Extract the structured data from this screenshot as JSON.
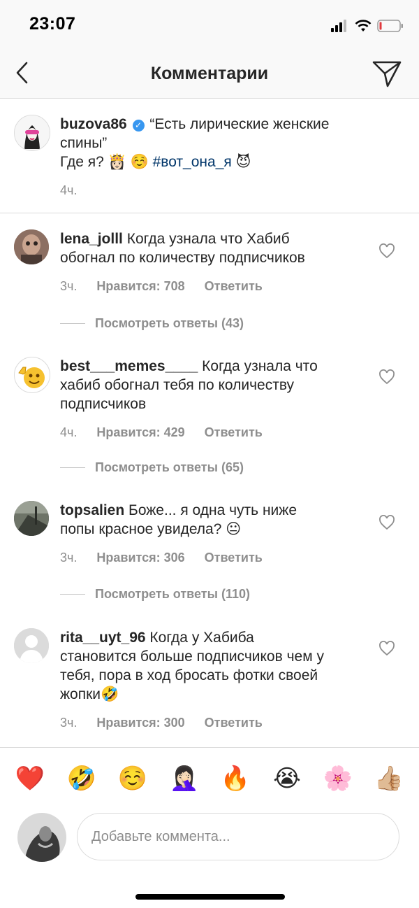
{
  "status_bar": {
    "time": "23:07"
  },
  "header": {
    "title": "Комментарии"
  },
  "caption": {
    "username": "buzova86",
    "text_line1": "“Есть лирические женские",
    "text_line2": "спины”",
    "text_line3_prefix": "Где я? ",
    "emoji_1": "👸🏻",
    "emoji_2": "☺️",
    "hashtag": "#вот_она_я",
    "emoji_3": "😈",
    "time_ago": "4ч."
  },
  "comments": [
    {
      "username": "lena_jolll",
      "lines": [
        "Когда узнала что Хабиб",
        "обогнал по количеству подписчиков"
      ],
      "time_ago": "3ч.",
      "likes": "Нравится: 708",
      "reply": "Ответить",
      "view_replies": "Посмотреть ответы (43)"
    },
    {
      "username": "best___memes____",
      "lines": [
        "Когда узнала что",
        "хабиб обогнал тебя по количеству",
        "подписчиков"
      ],
      "time_ago": "4ч.",
      "likes": "Нравится: 429",
      "reply": "Ответить",
      "view_replies": "Посмотреть ответы (65)"
    },
    {
      "username": "topsalien",
      "lines": [
        "Боже... я одна чуть ниже",
        "попы красное увидела? 😐"
      ],
      "time_ago": "3ч.",
      "likes": "Нравится: 306",
      "reply": "Ответить",
      "view_replies": "Посмотреть ответы (110)"
    },
    {
      "username": "rita__uyt_96",
      "lines": [
        "Когда у Хабиба",
        "становится больше подписчиков чем у",
        "тебя, пора в ход бросать фотки своей",
        "жопки🤣"
      ],
      "time_ago": "3ч.",
      "likes": "Нравится: 300",
      "reply": "Ответить"
    }
  ],
  "emoji_bar": [
    "❤️",
    "🤣",
    "☺️",
    "🤦🏻‍♀️",
    "🔥",
    "😭",
    "🌸",
    "👍🏼"
  ],
  "composer": {
    "placeholder": "Добавьте коммента..."
  },
  "colors": {
    "accent_link": "#003569",
    "verified": "#3897f0",
    "muted": "#8e8e8e"
  }
}
